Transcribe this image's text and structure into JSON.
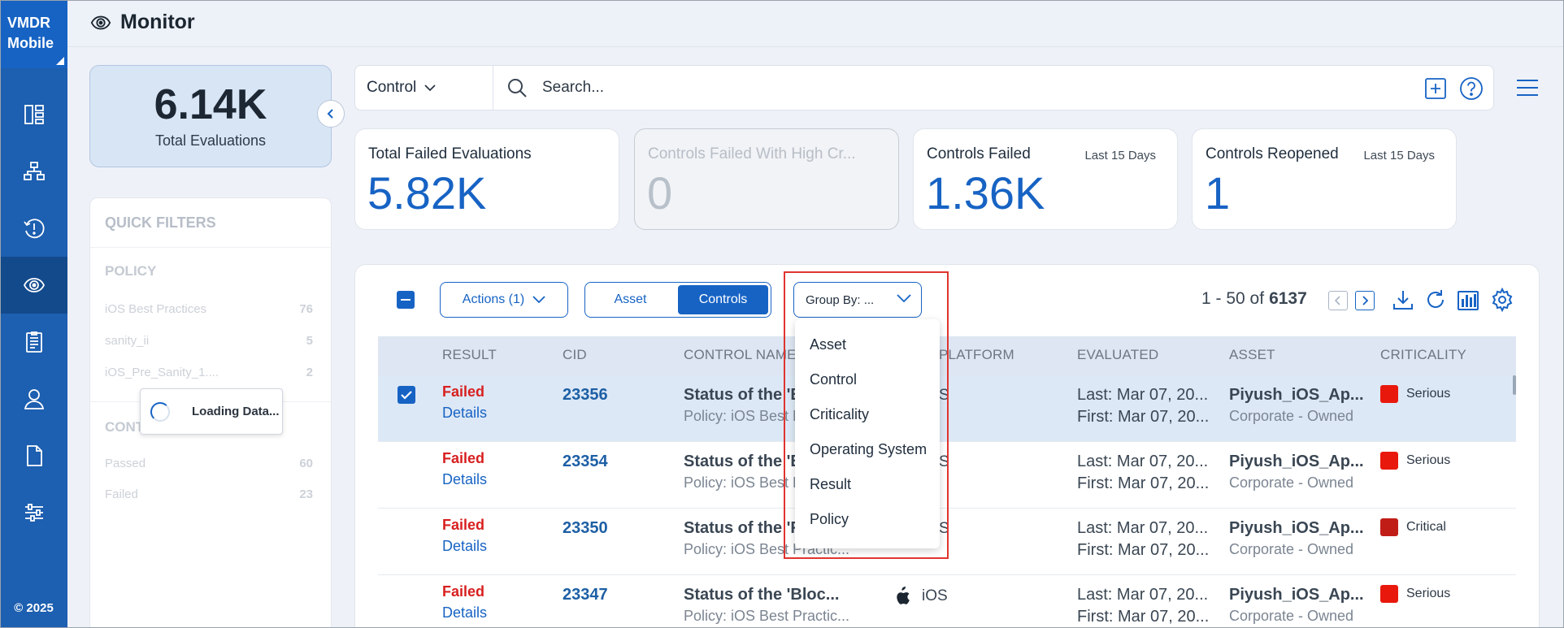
{
  "nav": {
    "brand_line1": "VMDR",
    "brand_line2": "Mobile",
    "items": [
      "dashboard-icon",
      "inventory-icon",
      "vulnerability-icon",
      "monitor-icon",
      "report-icon",
      "user-icon",
      "document-icon",
      "settings-sliders-icon"
    ],
    "active_index": 3,
    "copyright": "© 2025"
  },
  "header": {
    "title": "Monitor"
  },
  "summary": {
    "value": "6.14K",
    "label": "Total Evaluations"
  },
  "quick_filters": {
    "title": "QUICK FILTERS",
    "policy_section": "POLICY",
    "policy_items": [
      {
        "label": "iOS Best Practices",
        "count": "76"
      },
      {
        "label": "sanity_ii",
        "count": "5"
      },
      {
        "label": "iOS_Pre_Sanity_1....",
        "count": "2"
      }
    ],
    "control_section": "CONT",
    "control_items": [
      {
        "label": "Passed",
        "count": "60"
      },
      {
        "label": "Failed",
        "count": "23"
      }
    ],
    "loading_text": "Loading Data..."
  },
  "search": {
    "type": "Control",
    "placeholder": "Search..."
  },
  "stats": [
    {
      "label": "Total Failed Evaluations",
      "sub": "",
      "value": "5.82K",
      "disabled": false
    },
    {
      "label": "Controls Failed With High Cr...",
      "sub": "",
      "value": "0",
      "disabled": true
    },
    {
      "label": "Controls Failed",
      "sub": "Last 15 Days",
      "value": "1.36K",
      "disabled": false
    },
    {
      "label": "Controls Reopened",
      "sub": "Last 15 Days",
      "value": "1",
      "disabled": false
    }
  ],
  "toolbar": {
    "actions_label": "Actions (1)",
    "toggle_asset": "Asset",
    "toggle_controls": "Controls",
    "groupby_label": "Group By: ...",
    "pager_range": "1 - 50 of",
    "pager_total": "6137"
  },
  "groupby_options": [
    "Asset",
    "Control",
    "Criticality",
    "Operating System",
    "Result",
    "Policy"
  ],
  "table": {
    "headers": [
      "RESULT",
      "CID",
      "CONTROL NAME",
      "PLATFORM",
      "EVALUATED",
      "ASSET",
      "CRITICALITY"
    ],
    "rows": [
      {
        "result": "Failed",
        "details": "Details",
        "cid": "23356",
        "control": "Status of the 'E",
        "policy": "Policy: iOS Best P",
        "platform": "S",
        "last": "Last: Mar 07, 20...",
        "first": "First: Mar 07, 20...",
        "asset": "Piyush_iOS_Ap...",
        "owner": "Corporate - Owned",
        "criticality": "Serious",
        "crit_color": "#e8190c",
        "selected": true
      },
      {
        "result": "Failed",
        "details": "Details",
        "cid": "23354",
        "control": "Status of the 'E",
        "policy": "Policy: iOS Best P",
        "platform": "S",
        "last": "Last: Mar 07, 20...",
        "first": "First: Mar 07, 20...",
        "asset": "Piyush_iOS_Ap...",
        "owner": "Corporate - Owned",
        "criticality": "Serious",
        "crit_color": "#e8190c",
        "selected": false
      },
      {
        "result": "Failed",
        "details": "Details",
        "cid": "23350",
        "control": "Status of the 'F",
        "policy": "Policy: iOS Best Practic...",
        "platform": "S",
        "last": "Last: Mar 07, 20...",
        "first": "First: Mar 07, 20...",
        "asset": "Piyush_iOS_Ap...",
        "owner": "Corporate - Owned",
        "criticality": "Critical",
        "crit_color": "#c01d17",
        "selected": false
      },
      {
        "result": "Failed",
        "details": "Details",
        "cid": "23347",
        "control": "Status of the 'Bloc...",
        "policy": "Policy: iOS Best Practic...",
        "platform": "iOS",
        "last": "Last: Mar 07, 20...",
        "first": "First: Mar 07, 20...",
        "asset": "Piyush_iOS_Ap...",
        "owner": "Corporate - Owned",
        "criticality": "Serious",
        "crit_color": "#e8190c",
        "selected": false
      }
    ]
  },
  "colors": {
    "brand": "#1763c4",
    "nav": "#1d5fb0",
    "failed": "#d81f1f",
    "highlight": "#e0342f"
  }
}
